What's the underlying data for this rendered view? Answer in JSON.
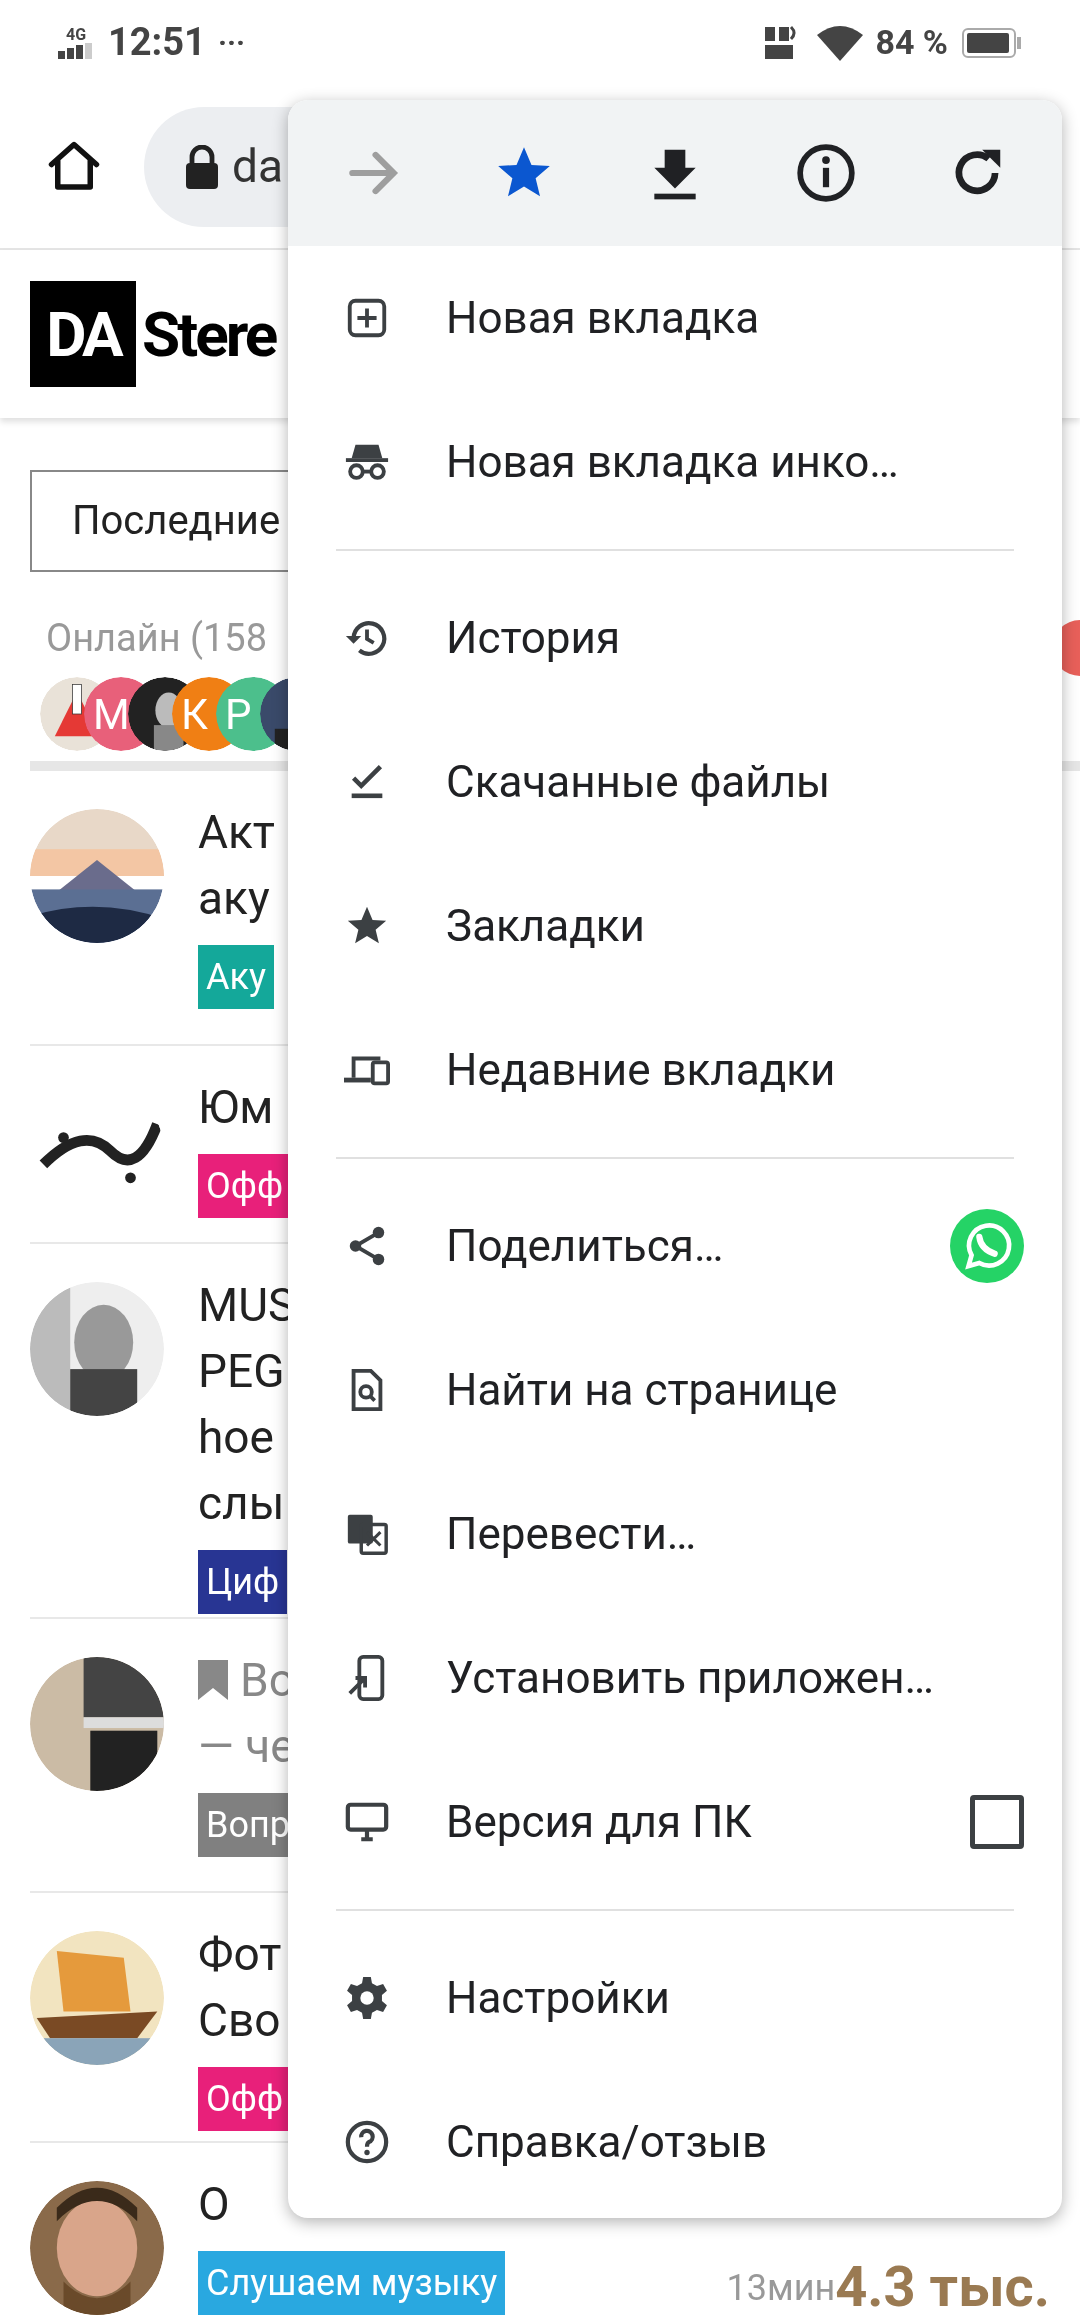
{
  "status_bar": {
    "network": "4G",
    "time": "12:51",
    "more": "···",
    "battery": "84 %"
  },
  "toolbar": {
    "url": "da"
  },
  "page": {
    "logo": {
      "mark": "DA",
      "name": "Stere"
    },
    "filter": "Последние",
    "online": "Онлайн (158",
    "online_avatars": [
      {
        "kind": "picture"
      },
      {
        "kind": "letter",
        "letter": "М",
        "color": "#e8607a"
      },
      {
        "kind": "picture"
      },
      {
        "kind": "letter",
        "letter": "К",
        "color": "#f07f14"
      },
      {
        "kind": "letter",
        "letter": "Р",
        "color": "#4cbf8c"
      },
      {
        "kind": "picture"
      }
    ],
    "topics": [
      {
        "title_lines": [
          "Акт",
          "аку"
        ],
        "tag": "Аку",
        "color": "#14a89a",
        "bookmarked": false
      },
      {
        "title_lines": [
          "Юм"
        ],
        "tag": "Офф",
        "color": "#e8207a",
        "bookmarked": false
      },
      {
        "title_lines": [
          "MUS",
          "PEG",
          "hoe",
          "слы"
        ],
        "tag": "Циф",
        "color": "#283593",
        "bookmarked": false
      },
      {
        "title_lines": [
          "Во",
          "— че"
        ],
        "tag": "Вопр",
        "color": "#808080",
        "bookmarked": true
      },
      {
        "title_lines": [
          "Фот",
          "Сво"
        ],
        "tag": "Офф",
        "color": "#e8207a",
        "bookmarked": false
      },
      {
        "title_lines": [
          "О"
        ],
        "tag": "Слушаем музыку",
        "color": "#29a8e0",
        "bookmarked": false,
        "time": "13мин",
        "views": "4.3 тыс."
      }
    ]
  },
  "menu": {
    "actions": [
      {
        "kind": "forward",
        "disabled": true
      },
      {
        "kind": "bookmark",
        "on": true
      },
      {
        "kind": "download",
        "disabled": false
      },
      {
        "kind": "info",
        "disabled": false
      },
      {
        "kind": "reload",
        "disabled": false
      }
    ],
    "sections": [
      [
        {
          "label": "Новая вкладка"
        },
        {
          "label": "Новая вкладка инко…"
        }
      ],
      [
        {
          "label": "История"
        },
        {
          "label": "Скачанные файлы"
        },
        {
          "label": "Закладки"
        },
        {
          "label": "Недавние вкладки"
        }
      ],
      [
        {
          "label": "Поделиться…",
          "extra": {
            "kind": "app"
          }
        },
        {
          "label": "Найти на странице"
        },
        {
          "label": "Перевести…"
        },
        {
          "label": "Установить приложен…"
        },
        {
          "label": "Версия для ПК",
          "extra": {
            "kind": "checkbox",
            "checked": false
          }
        }
      ],
      [
        {
          "label": "Настройки"
        },
        {
          "label": "Справка/отзыв"
        }
      ]
    ]
  }
}
